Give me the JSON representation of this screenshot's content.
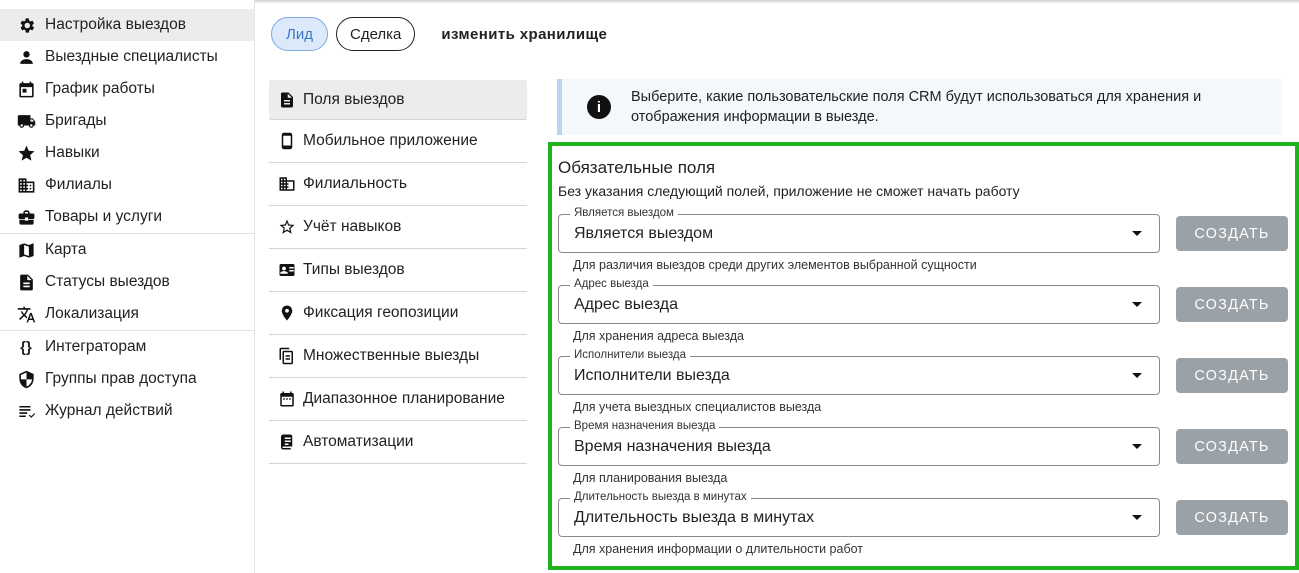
{
  "sidebar": {
    "groups": [
      [
        {
          "label": "Настройка выездов",
          "icon": "gear-icon",
          "active": true
        },
        {
          "label": "Выездные специалисты",
          "icon": "person-icon"
        },
        {
          "label": "График работы",
          "icon": "calendar-icon"
        },
        {
          "label": "Бригады",
          "icon": "truck-icon"
        },
        {
          "label": "Навыки",
          "icon": "star-icon"
        },
        {
          "label": "Филиалы",
          "icon": "building-icon"
        },
        {
          "label": "Товары и услуги",
          "icon": "briefcase-icon"
        }
      ],
      [
        {
          "label": "Карта",
          "icon": "map-icon"
        },
        {
          "label": "Статусы выездов",
          "icon": "document-icon"
        },
        {
          "label": "Локализация",
          "icon": "translate-icon"
        }
      ],
      [
        {
          "label": "Интеграторам",
          "icon": "code-braces-icon"
        },
        {
          "label": "Группы прав доступа",
          "icon": "shield-icon"
        },
        {
          "label": "Журнал действий",
          "icon": "list-icon"
        }
      ]
    ]
  },
  "tabs": {
    "lead": "Лид",
    "deal": "Сделка",
    "change_storage": "изменить хранилище"
  },
  "menu": {
    "items": [
      {
        "label": "Поля выездов",
        "icon": "document-icon",
        "active": true
      },
      {
        "label": "Мобильное приложение",
        "icon": "phone-icon"
      },
      {
        "label": "Филиальность",
        "icon": "building-icon"
      },
      {
        "label": "Учёт навыков",
        "icon": "star-outline-icon"
      },
      {
        "label": "Типы выездов",
        "icon": "id-card-icon"
      },
      {
        "label": "Фиксация геопозиции",
        "icon": "location-pin-icon"
      },
      {
        "label": "Множественные выезды",
        "icon": "documents-icon"
      },
      {
        "label": "Диапазонное планирование",
        "icon": "calendar-icon"
      },
      {
        "label": "Автоматизации",
        "icon": "script-icon"
      }
    ]
  },
  "info": {
    "icon": "info-icon",
    "text": "Выберите, какие пользовательские поля CRM будут использоваться для хранения и отображения информации в выезде."
  },
  "required": {
    "title": "Обязательные поля",
    "subtitle": "Без указания следующий полей, приложение не сможет начать работу",
    "create_label": "СОЗДАТЬ",
    "fields": [
      {
        "legend": "Является выездом",
        "value": "Является выездом",
        "helper": "Для различия выездов среди других элементов выбранной сущности"
      },
      {
        "legend": "Адрес выезда",
        "value": "Адрес выезда",
        "helper": "Для хранения адреса выезда"
      },
      {
        "legend": "Исполнители выезда",
        "value": "Исполнители выезда",
        "helper": "Для учета выездных специалистов выезда"
      },
      {
        "legend": "Время назначения выезда",
        "value": "Время назначения выезда",
        "helper": "Для планирования выезда"
      },
      {
        "legend": "Длительность выезда в минутах",
        "value": "Длительность выезда в минутах",
        "helper": "Для хранения информации о длительности работ"
      }
    ]
  },
  "colors": {
    "highlight_border": "#1db41d",
    "active_tab": "#3d78c6",
    "create_button": "#9aa1a7"
  }
}
